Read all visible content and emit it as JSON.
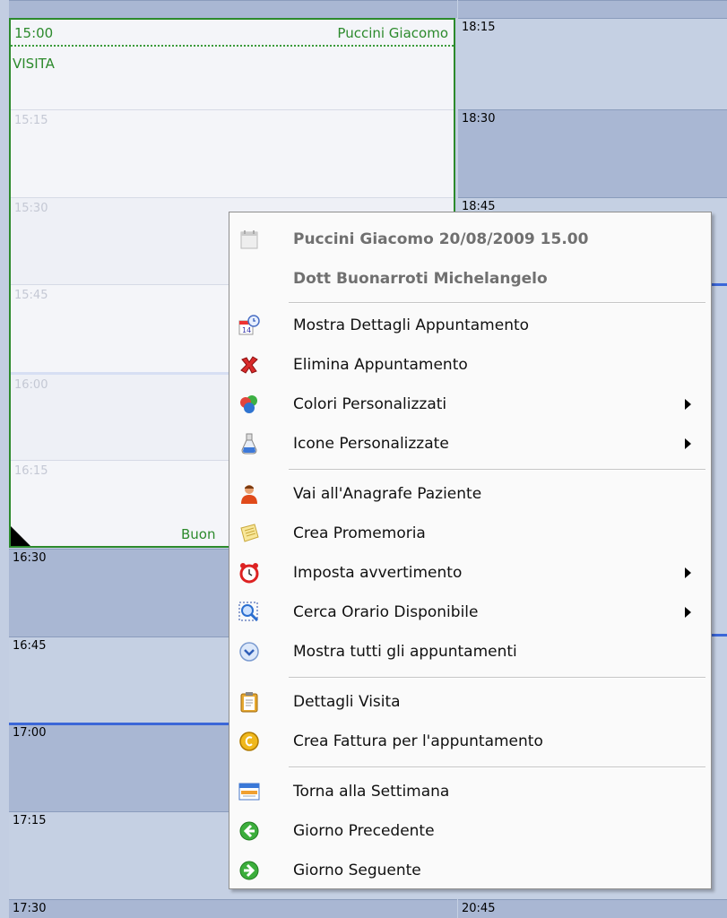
{
  "calendar": {
    "left_times": [
      "16:30",
      "16:45",
      "17:00",
      "17:15",
      "17:30"
    ],
    "right_times": [
      "18:15",
      "18:30",
      "18:45",
      "20:45"
    ]
  },
  "appointment": {
    "time": "15:00",
    "patient": "Puccini Giacomo",
    "type": "VISITA",
    "doctor_short": "Buon",
    "inner_times": [
      "15:15",
      "15:30",
      "15:45",
      "16:00",
      "16:15"
    ]
  },
  "menu": {
    "header_title": "Puccini Giacomo 20/08/2009 15.00",
    "header_doctor": "Dott Buonarroti Michelangelo",
    "items": [
      {
        "label": "Mostra Dettagli Appuntamento",
        "icon": "calendar-detail-icon"
      },
      {
        "label": "Elimina Appuntamento",
        "icon": "red-x-icon"
      },
      {
        "label": "Colori Personalizzati",
        "icon": "color-balls-icon",
        "submenu": true
      },
      {
        "label": "Icone Personalizzate",
        "icon": "flask-icon",
        "submenu": true
      },
      {
        "label": "Vai all'Anagrafe Paziente",
        "icon": "patient-icon"
      },
      {
        "label": "Crea Promemoria",
        "icon": "note-icon"
      },
      {
        "label": "Imposta avvertimento",
        "icon": "alarm-clock-icon",
        "submenu": true
      },
      {
        "label": "Cerca Orario Disponibile",
        "icon": "magnifier-icon",
        "submenu": true
      },
      {
        "label": "Mostra tutti gli appuntamenti",
        "icon": "chevron-circle-icon"
      },
      {
        "label": "Dettagli Visita",
        "icon": "clipboard-icon"
      },
      {
        "label": "Crea Fattura per l'appuntamento",
        "icon": "invoice-coin-icon"
      },
      {
        "label": "Torna alla Settimana",
        "icon": "week-calendar-icon"
      },
      {
        "label": "Giorno Precedente",
        "icon": "green-left-arrow-icon"
      },
      {
        "label": "Giorno Seguente",
        "icon": "green-right-arrow-icon"
      }
    ]
  }
}
